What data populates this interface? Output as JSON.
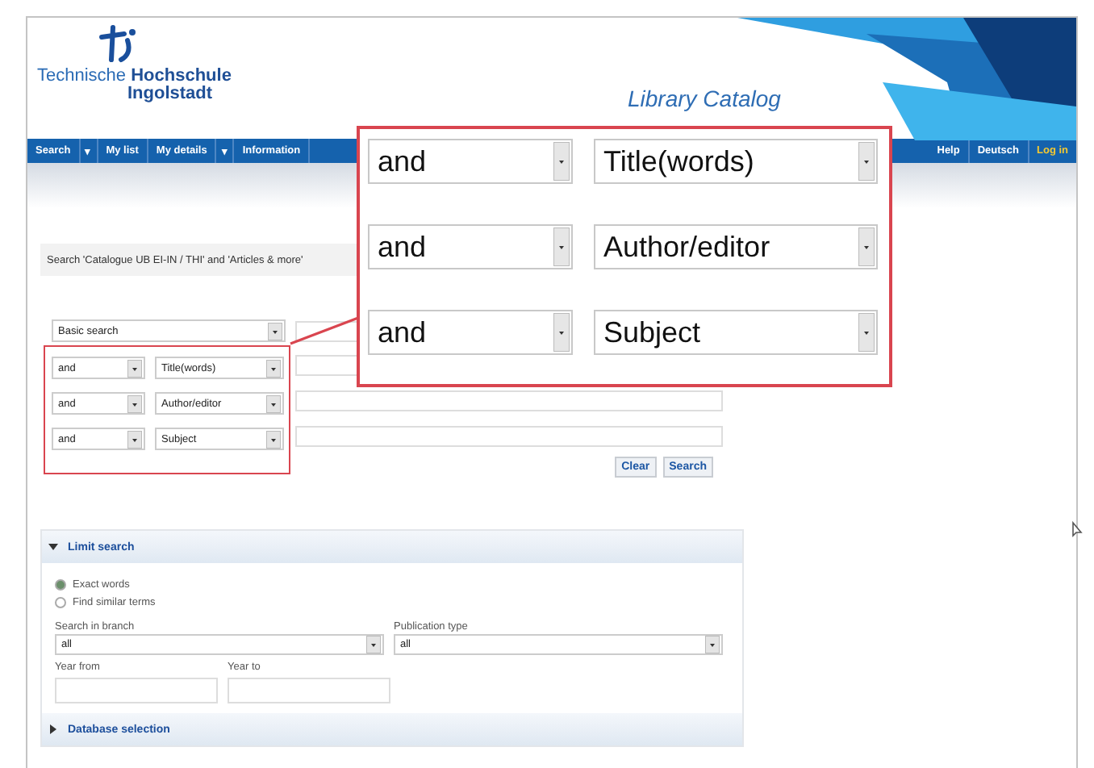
{
  "header": {
    "logo_line1": "Technische **Hochschule**",
    "logo_line2": "Ingolstadt",
    "title": "Library Catalog"
  },
  "nav": {
    "left": [
      {
        "label": "Search",
        "kind": "link"
      },
      {
        "label": "▾",
        "kind": "caret"
      },
      {
        "label": "My list",
        "kind": "link"
      },
      {
        "label": "My details",
        "kind": "link"
      },
      {
        "label": "▾",
        "kind": "caret"
      },
      {
        "label": "Information",
        "kind": "link"
      }
    ],
    "right": [
      {
        "label": "Help",
        "highlighted": false
      },
      {
        "label": "Deutsch",
        "highlighted": false
      },
      {
        "label": "Log in",
        "highlighted": true
      }
    ]
  },
  "search": {
    "heading": "Search 'Catalogue UB EI-IN / THI' and 'Articles & more'",
    "mode": "Basic search",
    "rows": [
      {
        "operator": "and",
        "field": "Title(words)"
      },
      {
        "operator": "and",
        "field": "Author/editor"
      },
      {
        "operator": "and",
        "field": "Subject"
      }
    ],
    "buttons": [
      "Clear",
      "Search"
    ]
  },
  "callout": {
    "rows": [
      {
        "operator": "and",
        "field": "Title(words)"
      },
      {
        "operator": "and",
        "field": "Author/editor"
      },
      {
        "operator": "and",
        "field": "Subject"
      }
    ]
  },
  "limit": {
    "title": "Limit search",
    "expanded": true,
    "options": [
      {
        "label": "Exact words",
        "selected": true
      },
      {
        "label": "Find similar terms",
        "selected": false
      }
    ],
    "branch": {
      "label": "Search in branch",
      "value": "all"
    },
    "pubtype": {
      "label": "Publication type",
      "value": "all"
    },
    "year_from": "Year from",
    "year_to": "Year to"
  },
  "database": {
    "title": "Database selection",
    "expanded": false
  }
}
